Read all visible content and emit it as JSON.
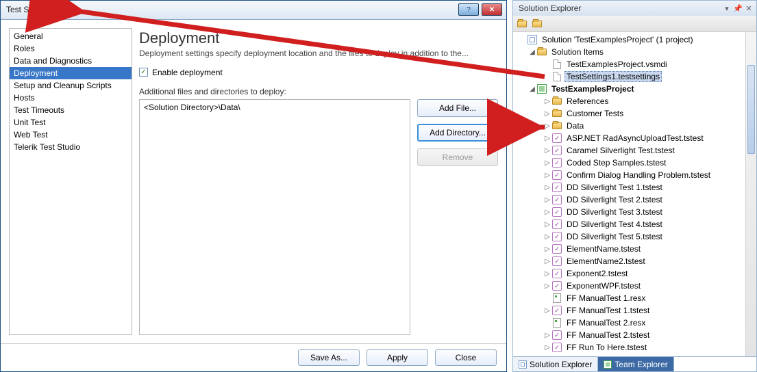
{
  "dialog": {
    "title": "Test Settings",
    "heading": "Deployment",
    "subheading": "Deployment settings specify deployment location and the files to deploy in addition to the...",
    "enable_deployment_label": "Enable deployment",
    "enable_deployment_checked": true,
    "additional_label": "Additional files and directories to deploy:",
    "list_entry": "<Solution Directory>\\Data\\",
    "buttons": {
      "add_file": "Add File...",
      "add_directory": "Add Directory...",
      "remove": "Remove"
    },
    "footer": {
      "save_as": "Save As...",
      "apply": "Apply",
      "close": "Close"
    }
  },
  "sidebar": {
    "items": [
      "General",
      "Roles",
      "Data and Diagnostics",
      "Deployment",
      "Setup and Cleanup Scripts",
      "Hosts",
      "Test Timeouts",
      "Unit Test",
      "Web Test",
      "Telerik Test Studio"
    ],
    "selected_index": 3
  },
  "explorer": {
    "title": "Solution Explorer",
    "solution_label": "Solution 'TestExamplesProject' (1 project)",
    "solution_items_label": "Solution Items",
    "files": {
      "vsmdi": "TestExamplesProject.vsmdi",
      "testsettings": "TestSettings1.testsettings"
    },
    "project_label": "TestExamplesProject",
    "project_children": [
      {
        "name": "References",
        "icon": "folder",
        "expandable": true
      },
      {
        "name": "Customer Tests",
        "icon": "folder",
        "expandable": true
      },
      {
        "name": "Data",
        "icon": "folder",
        "expandable": true
      },
      {
        "name": "ASP.NET RadAsyncUploadTest.tstest",
        "icon": "test",
        "expandable": true
      },
      {
        "name": "Caramel Silverlight Test.tstest",
        "icon": "test",
        "expandable": true
      },
      {
        "name": "Coded Step Samples.tstest",
        "icon": "test",
        "expandable": true
      },
      {
        "name": "Confirm Dialog Handling Problem.tstest",
        "icon": "test",
        "expandable": true
      },
      {
        "name": "DD Silverlight Test 1.tstest",
        "icon": "test",
        "expandable": true
      },
      {
        "name": "DD Silverlight Test 2.tstest",
        "icon": "test",
        "expandable": true
      },
      {
        "name": "DD Silverlight Test 3.tstest",
        "icon": "test",
        "expandable": true
      },
      {
        "name": "DD Silverlight Test 4.tstest",
        "icon": "test",
        "expandable": true
      },
      {
        "name": "DD Silverlight Test 5.tstest",
        "icon": "test",
        "expandable": true
      },
      {
        "name": "ElementName.tstest",
        "icon": "test",
        "expandable": true
      },
      {
        "name": "ElementName2.tstest",
        "icon": "test",
        "expandable": true
      },
      {
        "name": "Exponent2.tstest",
        "icon": "test",
        "expandable": true
      },
      {
        "name": "ExponentWPF.tstest",
        "icon": "test",
        "expandable": true
      },
      {
        "name": "FF ManualTest 1.resx",
        "icon": "resx",
        "expandable": false
      },
      {
        "name": "FF ManualTest 1.tstest",
        "icon": "test",
        "expandable": true
      },
      {
        "name": "FF ManualTest 2.resx",
        "icon": "resx",
        "expandable": false
      },
      {
        "name": "FF ManualTest 2.tstest",
        "icon": "test",
        "expandable": true
      },
      {
        "name": "FF Run To Here.tstest",
        "icon": "test",
        "expandable": true
      }
    ],
    "bottom_tabs": {
      "solution_explorer": "Solution Explorer",
      "team_explorer": "Team Explorer"
    }
  }
}
